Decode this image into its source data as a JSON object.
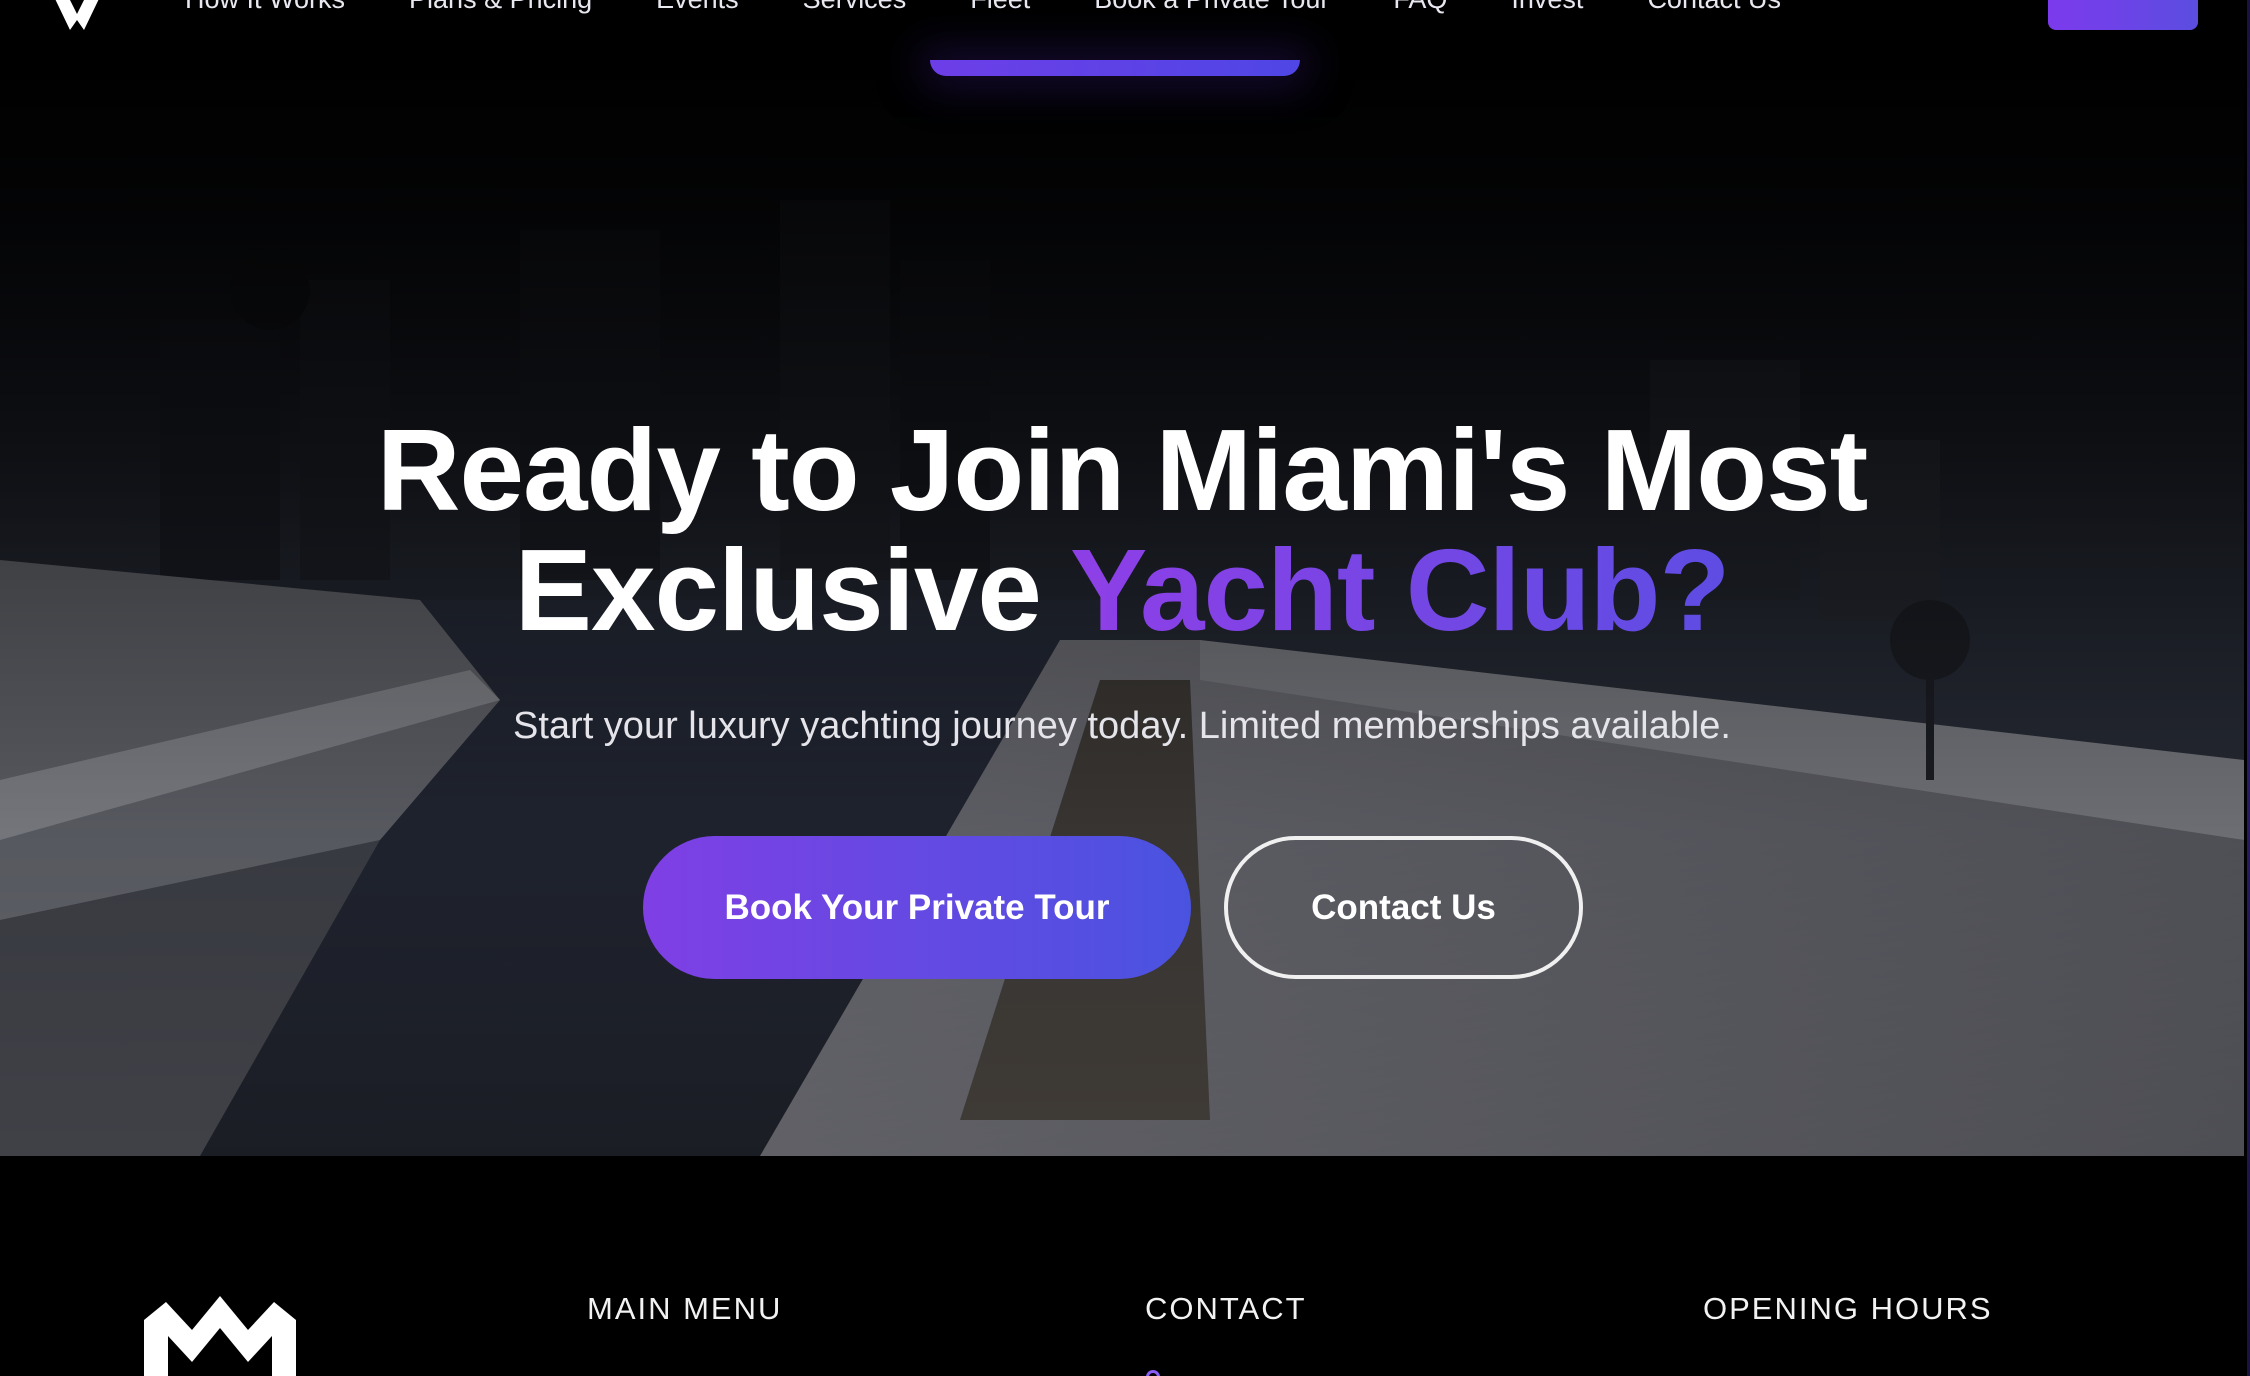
{
  "nav": {
    "links": [
      "How It Works",
      "Plans & Pricing",
      "Events",
      "Services",
      "Fleet",
      "Book a Private Tour",
      "FAQ",
      "Invest",
      "Contact Us"
    ],
    "cta_label": ""
  },
  "hero": {
    "title_line1": "Ready to Join Miami's Most",
    "title_line2_plain": "Exclusive",
    "title_line2_accent": "Yacht Club?",
    "subtitle": "Start your luxury yachting journey today. Limited memberships available.",
    "primary_button": "Book Your Private Tour",
    "secondary_button": "Contact Us"
  },
  "footer": {
    "headings": {
      "main_menu": "MAIN MENU",
      "contact": "CONTACT",
      "opening_hours": "OPENING HOURS"
    }
  },
  "colors": {
    "accent_purple": "#7f3fe4",
    "accent_indigo": "#4a53e0",
    "background": "#000000"
  },
  "icons": {
    "logo": "brand-logo-icon",
    "contact": "location-pin-icon"
  }
}
